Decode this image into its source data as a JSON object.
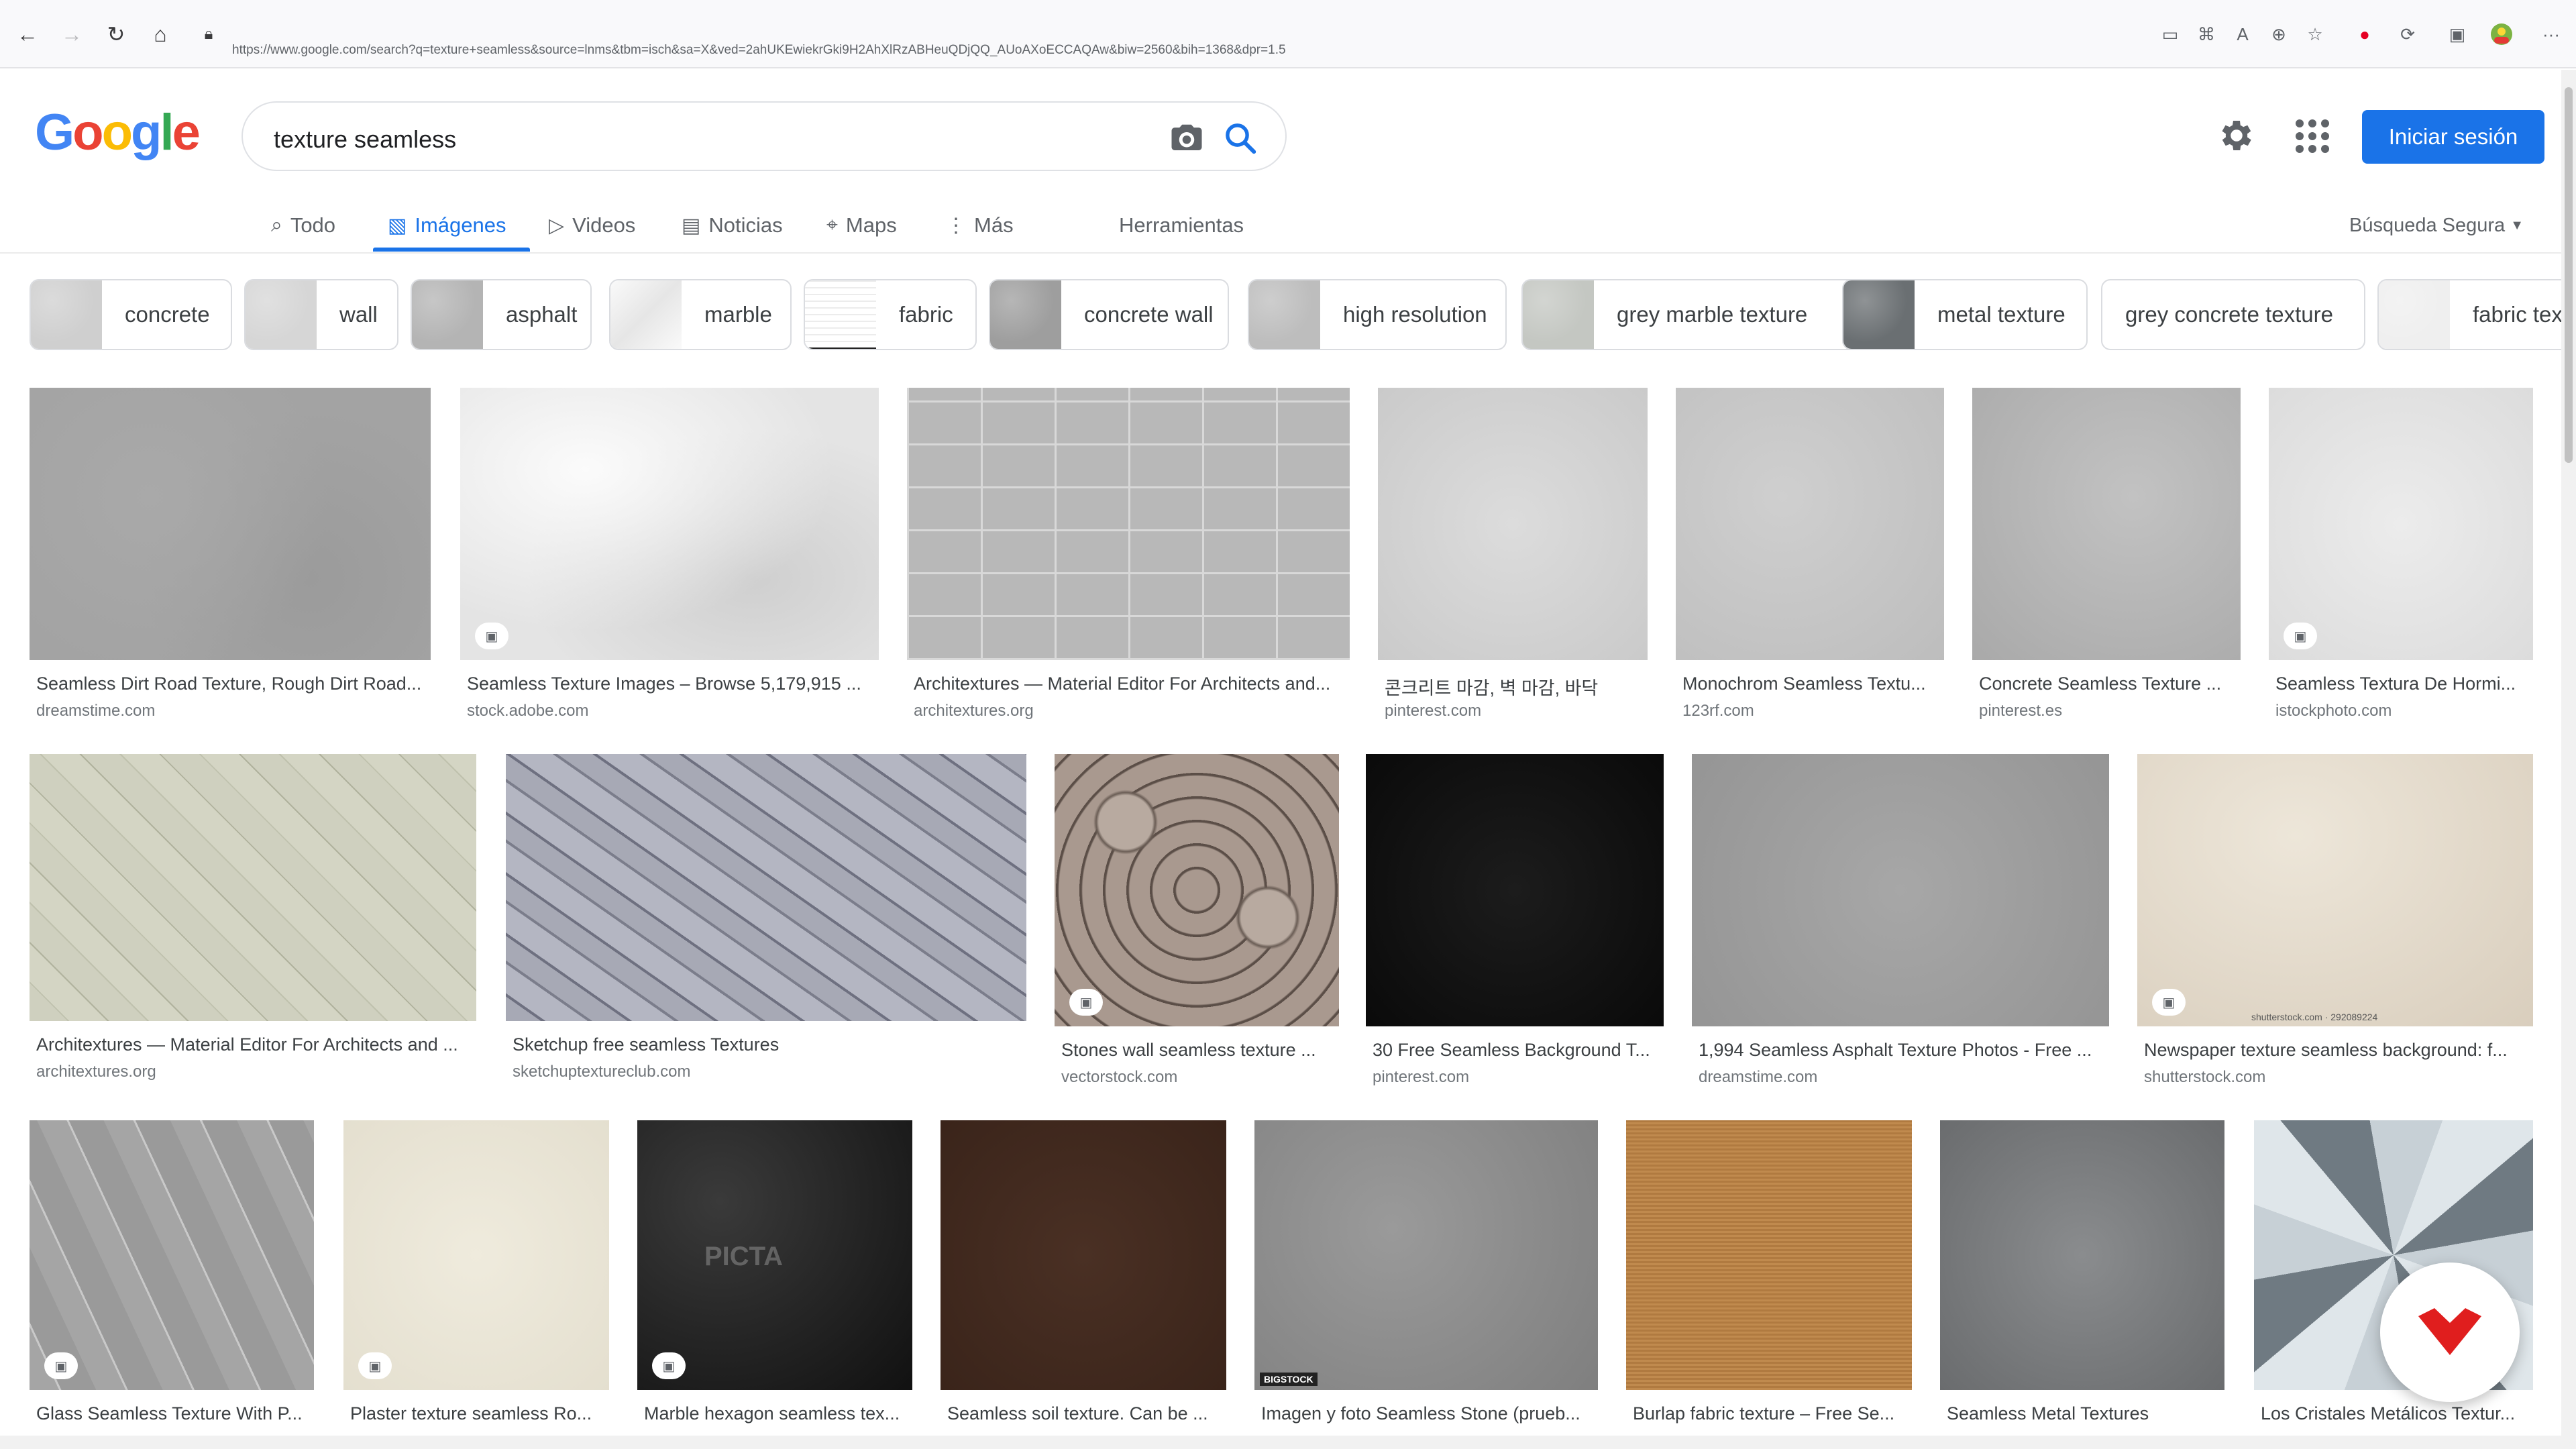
{
  "browser": {
    "url": "https://www.google.com/search?q=texture+seamless&source=lnms&tbm=isch&sa=X&ved=2ahUKEwiekrGki9H2AhXlRzABHeuQDjQQ_AUoAXoECCAQAw&biw=2560&bih=1368&dpr=1.5"
  },
  "logo": {
    "letters": [
      "G",
      "o",
      "o",
      "g",
      "l",
      "e"
    ],
    "colors": [
      "#4285f4",
      "#ea4335",
      "#fbbc05",
      "#4285f4",
      "#34a853",
      "#ea4335"
    ]
  },
  "search": {
    "query": "texture seamless"
  },
  "header": {
    "signin": "Iniciar sesión"
  },
  "tabs": [
    {
      "label": "Todo",
      "icon": "search-icon"
    },
    {
      "label": "Imágenes",
      "icon": "image-icon",
      "active": true
    },
    {
      "label": "Videos",
      "icon": "video-icon"
    },
    {
      "label": "Noticias",
      "icon": "news-icon"
    },
    {
      "label": "Maps",
      "icon": "map-pin-icon"
    },
    {
      "label": "Más",
      "icon": "more-vert-icon"
    },
    {
      "label": "Herramientas"
    }
  ],
  "safe_search": "Búsqueda Segura",
  "chips": [
    "concrete",
    "wall",
    "asphalt",
    "marble",
    "fabric",
    "concrete wall",
    "high resolution",
    "grey marble texture",
    "metal texture",
    "grey concrete texture",
    "fabric tex"
  ],
  "results": [
    {
      "title": "Seamless Dirt Road Texture, Rough Dirt Road...",
      "source": "dreamstime.com"
    },
    {
      "title": "Seamless Texture Images – Browse 5,179,915 ...",
      "source": "stock.adobe.com"
    },
    {
      "title": "Architextures — Material Editor For Architects and...",
      "source": "architextures.org"
    },
    {
      "title": "콘크리트 마감, 벽 마감, 바닥",
      "source": "pinterest.com"
    },
    {
      "title": "Monochrom Seamless Textu...",
      "source": "123rf.com"
    },
    {
      "title": "Concrete Seamless Texture ...",
      "source": "pinterest.es"
    },
    {
      "title": "Seamless Textura De Hormi...",
      "source": "istockphoto.com"
    },
    {
      "title": "Architextures — Material Editor For Architects and ...",
      "source": "architextures.org"
    },
    {
      "title": "Sketchup free seamless Textures",
      "source": "sketchuptextureclub.com"
    },
    {
      "title": "Stones wall seamless texture ...",
      "source": "vectorstock.com"
    },
    {
      "title": "30 Free Seamless Background T...",
      "source": "pinterest.com"
    },
    {
      "title": "1,994 Seamless Asphalt Texture Photos - Free ...",
      "source": "dreamstime.com"
    },
    {
      "title": "Newspaper texture seamless background: f...",
      "source": "shutterstock.com"
    },
    {
      "title": "Glass Seamless Texture With P...",
      "source": ""
    },
    {
      "title": "Plaster texture seamless Ro...",
      "source": ""
    },
    {
      "title": "Marble hexagon seamless tex...",
      "source": ""
    },
    {
      "title": "Seamless soil texture. Can be ...",
      "source": ""
    },
    {
      "title": "Imagen y foto Seamless Stone (prueb...",
      "source": ""
    },
    {
      "title": "Burlap fabric texture – Free Se...",
      "source": ""
    },
    {
      "title": "Seamless Metal Textures",
      "source": ""
    },
    {
      "title": "Los Cristales Metálicos Textur...",
      "source": ""
    }
  ],
  "watermarks": {
    "shutterstock": "shutterstock.com · 292089224",
    "bigstock": "BIGSTOCK",
    "picta": "PICTA"
  }
}
